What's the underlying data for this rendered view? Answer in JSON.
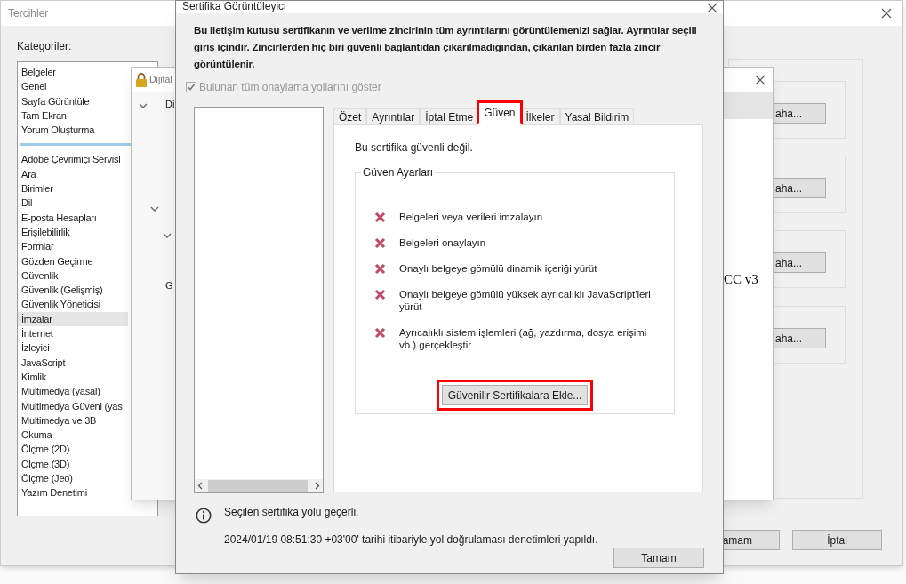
{
  "preferences_window": {
    "title": "Tercihler",
    "categories_label": "Kategoriler:",
    "category_groups": [
      {
        "items": [
          {
            "label": "Belgeler",
            "selected": false
          },
          {
            "label": "Genel",
            "selected": false
          },
          {
            "label": "Sayfa Görüntüle",
            "selected": false
          },
          {
            "label": "Tam Ekran",
            "selected": false
          },
          {
            "label": "Yorum Oluşturma",
            "selected": false
          }
        ]
      },
      {
        "items": [
          {
            "label": "Adobe Çevrimiçi Servisl",
            "selected": false
          },
          {
            "label": "Ara",
            "selected": false
          },
          {
            "label": "Birimler",
            "selected": false
          },
          {
            "label": "Dil",
            "selected": false
          },
          {
            "label": "E-posta Hesapları",
            "selected": false
          },
          {
            "label": "Erişilebilirlik",
            "selected": false
          },
          {
            "label": "Formlar",
            "selected": false
          },
          {
            "label": "Gözden Geçirme",
            "selected": false
          },
          {
            "label": "Güvenlik",
            "selected": false
          },
          {
            "label": "Güvenlik (Gelişmiş)",
            "selected": false
          },
          {
            "label": "Güvenlik Yöneticisi",
            "selected": false
          },
          {
            "label": "İmzalar",
            "selected": true
          },
          {
            "label": "İnternet",
            "selected": false
          },
          {
            "label": "İzleyici",
            "selected": false
          },
          {
            "label": "JavaScript",
            "selected": false
          },
          {
            "label": "Kimlik",
            "selected": false
          },
          {
            "label": "Multimedya (yasal)",
            "selected": false
          },
          {
            "label": "Multimedya Güveni (yas",
            "selected": false
          },
          {
            "label": "Multimedya ve 3B",
            "selected": false
          },
          {
            "label": "Okuma",
            "selected": false
          },
          {
            "label": "Ölçme (2D)",
            "selected": false
          },
          {
            "label": "Ölçme (3D)",
            "selected": false
          },
          {
            "label": "Ölçme (Jeo)",
            "selected": false
          },
          {
            "label": "Yazım Denetimi",
            "selected": false
          }
        ]
      }
    ],
    "section_buttons": [
      "aha...",
      "aha...",
      "aha...",
      "aha..."
    ],
    "buttons": [
      "amam",
      "İptal"
    ]
  },
  "digital_window": {
    "title": "Dijital",
    "labels": [
      "Di",
      "G"
    ],
    "right_text": "CC v3"
  },
  "certificate_viewer": {
    "title": "Sertifika Görüntüleyici",
    "description": "Bu iletişim kutusu sertifikanın ve verilme zincirinin tüm ayrıntılarını görüntülemenizi sağlar. Ayrıntılar seçili giriş içindir. Zincirlerden hiç biri güvenli bağlantıdan çıkarılmadığından, çıkarılan birden fazla zincir görüntülenir.",
    "show_all_paths": {
      "label": "Bulunan tüm onaylama yollarını göster",
      "checked": true,
      "disabled": true
    },
    "tabs": [
      {
        "label": "Özet",
        "selected": false,
        "highlighted": false
      },
      {
        "label": "Ayrıntılar",
        "selected": false,
        "highlighted": false
      },
      {
        "label": "İptal Etme",
        "selected": false,
        "highlighted": false
      },
      {
        "label": "Güven",
        "selected": true,
        "highlighted": true
      },
      {
        "label": "İlkeler",
        "selected": false,
        "highlighted": false
      },
      {
        "label": "Yasal Bildirim",
        "selected": false,
        "highlighted": false
      }
    ],
    "trust_status": "Bu sertifika güvenli değil.",
    "trust_settings": {
      "title": "Güven Ayarları",
      "permissions": [
        {
          "label": "Belgeleri veya verileri imzalayın",
          "allowed": false
        },
        {
          "label": "Belgeleri onaylayın",
          "allowed": false
        },
        {
          "label": "Onaylı belgeye gömülü dinamik içeriği yürüt",
          "allowed": false
        },
        {
          "label": "Onaylı belgeye gömülü yüksek ayrıcalıklı JavaScript'leri yürüt",
          "allowed": false
        },
        {
          "label": "Ayrıcalıklı sistem işlemleri (ağ, yazdırma, dosya erişimi vb.) gerçekleştir",
          "allowed": false
        }
      ],
      "add_button": {
        "label": "Güvenilir Sertifikalara Ekle...",
        "highlighted": true
      }
    },
    "path_status": "Seçilen sertifika yolu geçerli.",
    "validation_note": "2024/01/19 08:51:30 +03'00' tarihi itibariyle yol doğrulaması denetimleri yapıldı.",
    "ok_button": "Tamam"
  }
}
